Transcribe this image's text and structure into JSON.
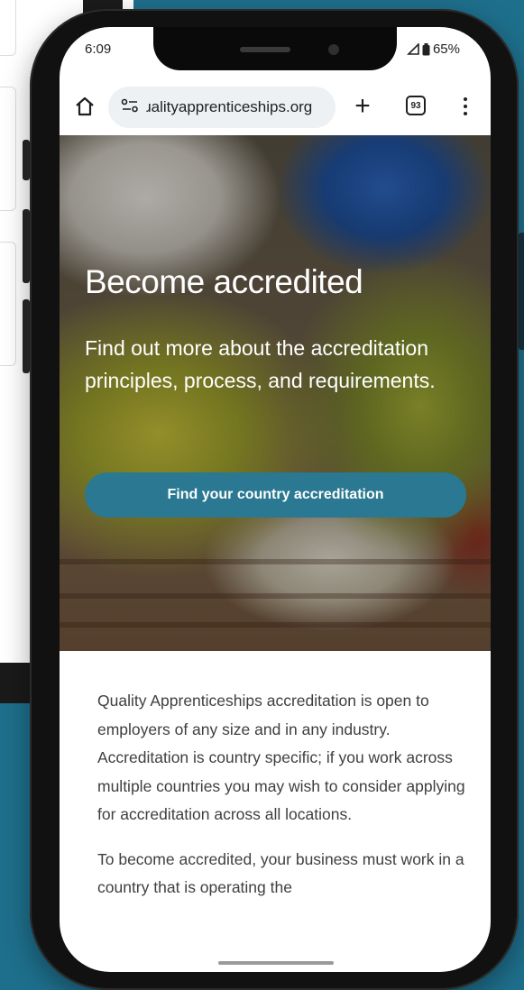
{
  "status_bar": {
    "time": "6:09",
    "battery": "65%"
  },
  "browser": {
    "url": "ɹalityapprenticeships.org",
    "tab_count": "93",
    "new_tab_label": "+"
  },
  "hero": {
    "title": "Become accredited",
    "subtitle": "Find out more about the accreditation principles, process, and requirements.",
    "button_label": "Find your country accreditation"
  },
  "body": {
    "paragraph_1": "Quality Apprenticeships accreditation is open to employers of any size and in any industry. Accreditation is country specific; if you work across multiple countries you may wish to consider applying for accreditation across all locations.",
    "paragraph_2": "To become accredited, your business must work in a country that is operating the"
  },
  "colors": {
    "background": "#1e6f8c",
    "button": "#2a7891",
    "text": "#3f3f3f"
  },
  "icons": {
    "home": "home-icon",
    "site_settings": "site-settings-icon",
    "menu": "more-vert-icon",
    "signal": "signal-icon",
    "battery": "battery-icon"
  }
}
